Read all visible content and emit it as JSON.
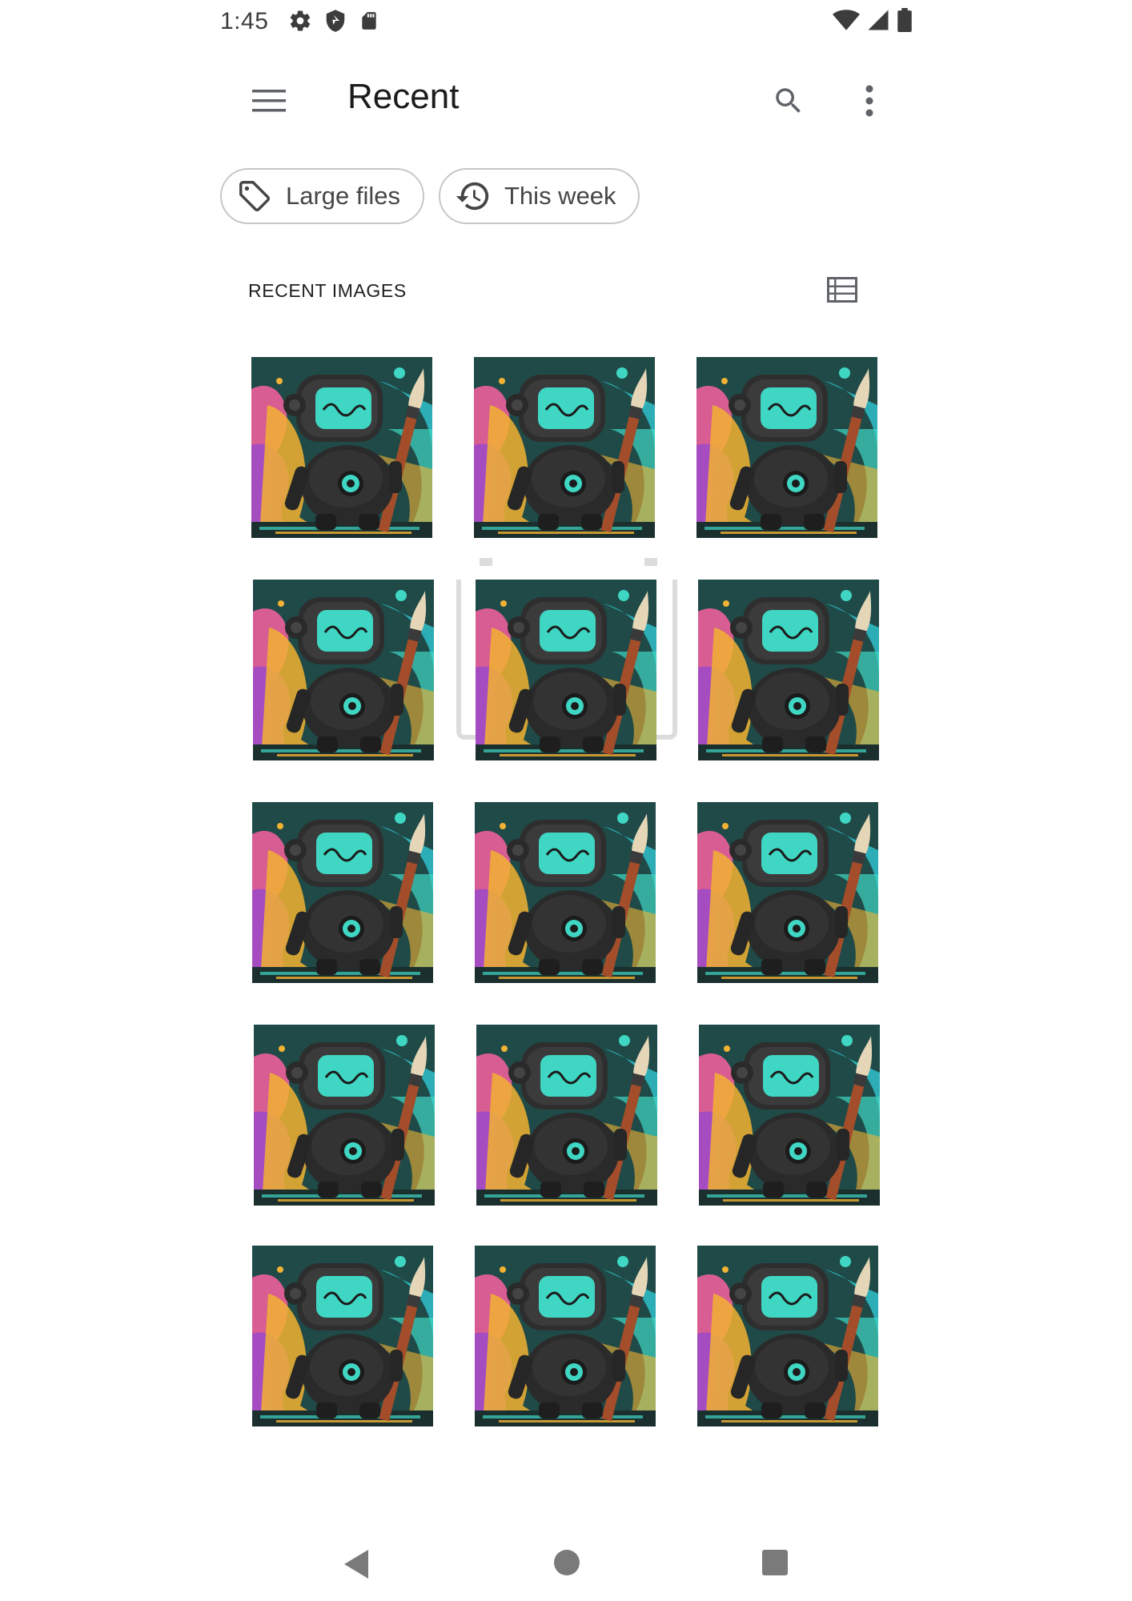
{
  "status_bar": {
    "time": "1:45",
    "left_icons": [
      "settings-icon",
      "shield-icon",
      "sd-card-icon"
    ],
    "right_icons": [
      "wifi-icon",
      "cellular-signal-icon",
      "battery-icon"
    ]
  },
  "app_bar": {
    "title": "Recent",
    "menu_icon": "hamburger-menu-icon",
    "search_icon": "search-icon",
    "more_icon": "more-vert-icon"
  },
  "filter_chips": [
    {
      "label": "Large files",
      "icon": "tag-icon"
    },
    {
      "label": "This week",
      "icon": "history-icon"
    }
  ],
  "section": {
    "title": "RECENT IMAGES",
    "view_toggle_icon": "list-view-icon"
  },
  "images": {
    "count": 15,
    "thumbnail_subject": "robot-painter-thumbnail"
  },
  "nav_bar": {
    "icons": [
      "back-icon",
      "home-icon",
      "recents-icon"
    ]
  },
  "colors": {
    "status_icon": "#3c3c3c",
    "chip_border": "#c7c7c7",
    "chip_text": "#444746",
    "title_text": "#1b1b1b",
    "nav_icon": "#7a7a7a",
    "selection_frame": "#dcdcdc",
    "thumb_bg": "#1f4a47",
    "robot_screen": "#3fd6c3"
  }
}
